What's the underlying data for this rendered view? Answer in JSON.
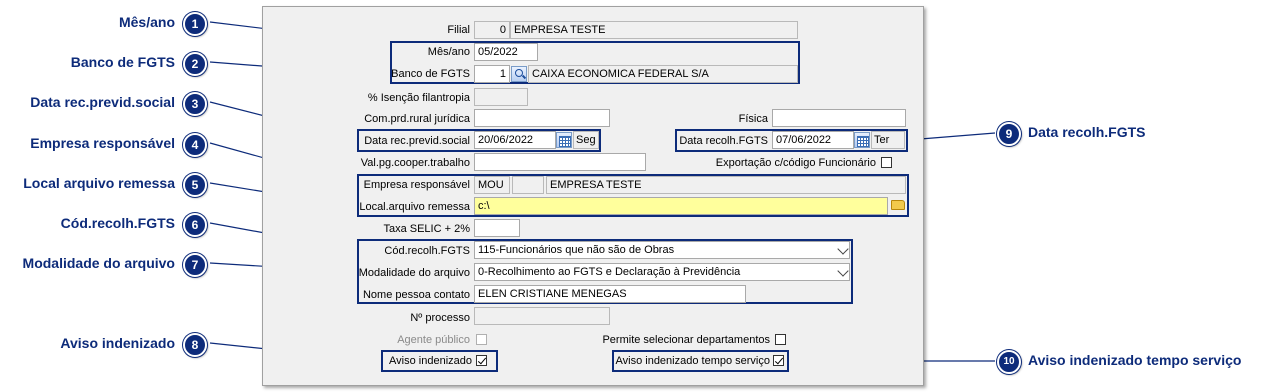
{
  "colors": {
    "accent": "#0d2b7a",
    "highlight_field": "#ffff9c",
    "panel": "#f0f0f0"
  },
  "callouts": [
    {
      "num": "1",
      "label": "Mês/ano"
    },
    {
      "num": "2",
      "label": "Banco de FGTS"
    },
    {
      "num": "3",
      "label": "Data rec.previd.social"
    },
    {
      "num": "4",
      "label": "Empresa responsável"
    },
    {
      "num": "5",
      "label": "Local arquivo remessa"
    },
    {
      "num": "6",
      "label": "Cód.recolh.FGTS"
    },
    {
      "num": "7",
      "label": "Modalidade do arquivo"
    },
    {
      "num": "8",
      "label": "Aviso indenizado"
    },
    {
      "num": "9",
      "label": "Data recolh.FGTS"
    },
    {
      "num": "10",
      "label": "Aviso indenizado tempo serviço"
    }
  ],
  "form": {
    "filial": {
      "label": "Filial",
      "code": "0",
      "name": "EMPRESA TESTE"
    },
    "mes_ano": {
      "label": "Mês/ano",
      "value": "05/2022"
    },
    "banco_fgts": {
      "label": "Banco de FGTS",
      "code": "1",
      "name": "CAIXA ECONOMICA FEDERAL S/A",
      "icon": "search-icon"
    },
    "isencao": {
      "label": "% Isenção filantropia",
      "value": ""
    },
    "com_prd_rural": {
      "label": "Com.prd.rural jurídica",
      "value": ""
    },
    "fisica": {
      "label": "Física",
      "value": ""
    },
    "data_rec_previd": {
      "label": "Data rec.previd.social",
      "value": "20/06/2022",
      "weekday": "Seg",
      "icon": "calendar-icon"
    },
    "data_recolh_fgts": {
      "label": "Data recolh.FGTS",
      "value": "07/06/2022",
      "weekday": "Ter",
      "icon": "calendar-icon"
    },
    "val_pg_cooper": {
      "label": "Val.pg.cooper.trabalho",
      "value": ""
    },
    "exportacao": {
      "label": "Exportação c/código Funcionário",
      "checked": false
    },
    "empresa_resp": {
      "label": "Empresa responsável",
      "code": "MOU",
      "name": "EMPRESA TESTE"
    },
    "local_arquivo": {
      "label": "Local.arquivo remessa",
      "value": "c:\\",
      "icon": "folder-icon"
    },
    "taxa_selic": {
      "label": "Taxa SELIC + 2%",
      "value": ""
    },
    "cod_recolh": {
      "label": "Cód.recolh.FGTS",
      "value": "115-Funcionários que não são de Obras"
    },
    "modalidade": {
      "label": "Modalidade do arquivo",
      "value": "0-Recolhimento ao FGTS e Declaração à Previdência"
    },
    "nome_contato": {
      "label": "Nome pessoa contato",
      "value": "ELEN CRISTIANE MENEGAS"
    },
    "nro_processo": {
      "label": "Nº processo",
      "value": ""
    },
    "agente_publico": {
      "label": "Agente público",
      "checked": false,
      "disabled": true
    },
    "permite_depto": {
      "label": "Permite selecionar departamentos",
      "checked": false
    },
    "aviso_indenizado": {
      "label": "Aviso indenizado",
      "checked": true
    },
    "aviso_tempo": {
      "label": "Aviso indenizado tempo serviço",
      "checked": true
    }
  }
}
